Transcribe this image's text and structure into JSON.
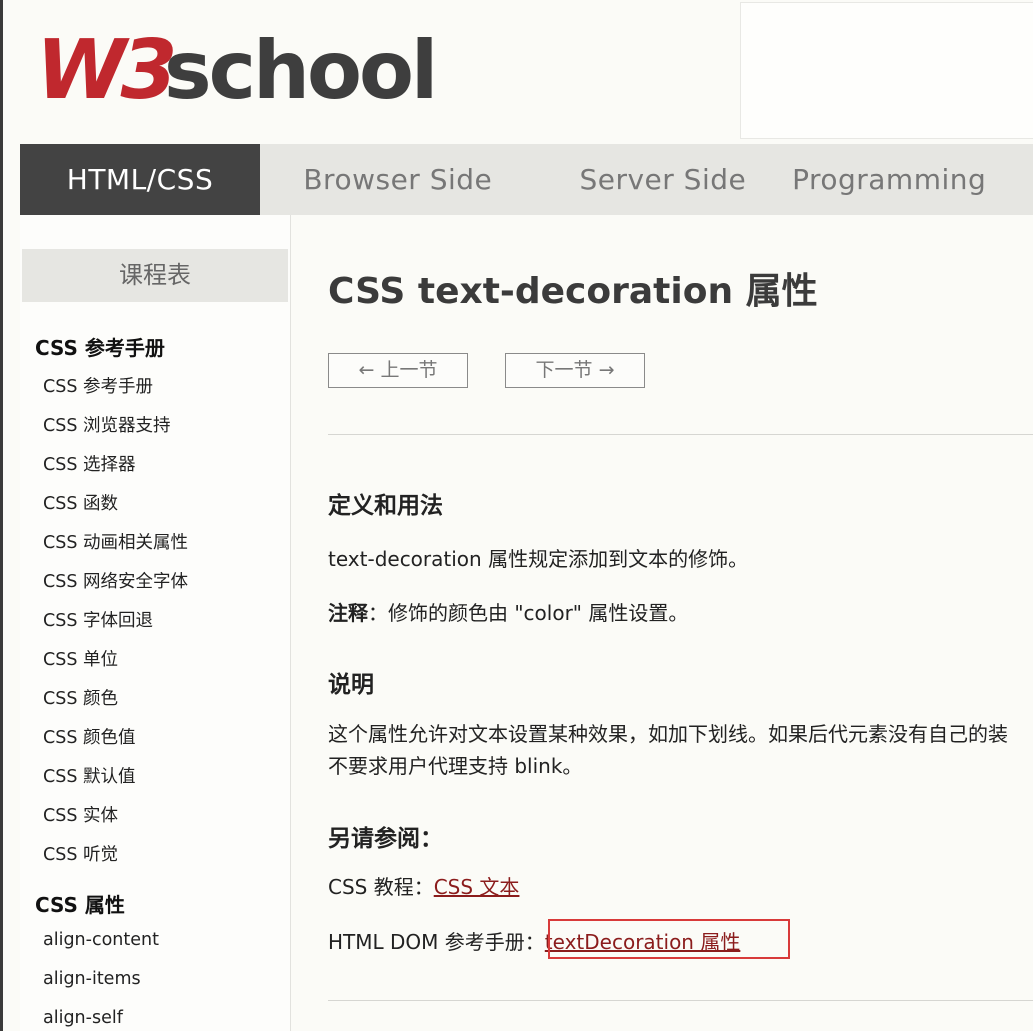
{
  "header": {
    "logo": {
      "w3": "W3",
      "school": "school"
    }
  },
  "nav": {
    "items": [
      "HTML/CSS",
      "Browser Side",
      "Server Side",
      "Programming"
    ]
  },
  "sidebar": {
    "title": "课程表",
    "sections": [
      {
        "title": "CSS 参考手册",
        "items": [
          "CSS 参考手册",
          "CSS 浏览器支持",
          "CSS 选择器",
          "CSS 函数",
          "CSS 动画相关属性",
          "CSS 网络安全字体",
          "CSS 字体回退",
          "CSS 单位",
          "CSS 颜色",
          "CSS 颜色值",
          "CSS 默认值",
          "CSS 实体",
          "CSS 听觉"
        ]
      },
      {
        "title": "CSS 属性",
        "items": [
          "align-content",
          "align-items",
          "align-self"
        ]
      }
    ]
  },
  "main": {
    "title": "CSS text-decoration 属性",
    "prev_label": "上一节",
    "next_label": "下一节",
    "definition": {
      "heading": "定义和用法",
      "text": "text-decoration 属性规定添加到文本的修饰。",
      "note_label": "注释",
      "note_text": "：修饰的颜色由 \"color\" 属性设置。"
    },
    "description": {
      "heading": "说明",
      "line1": "这个属性允许对文本设置某种效果，如加下划线。如果后代元素没有自己的装",
      "line2": "不要求用户代理支持 blink。"
    },
    "see_also": {
      "heading": "另请参阅：",
      "tutorial_label": "CSS 教程：",
      "tutorial_link": "CSS 文本",
      "dom_label": "HTML DOM 参考手册：",
      "dom_link": "textDecoration 属性"
    }
  },
  "colors": {
    "brand_red": "#c0282e",
    "brand_gray": "#3e3e3e",
    "link": "#8b1c1c",
    "highlight": "#d83a3a"
  }
}
